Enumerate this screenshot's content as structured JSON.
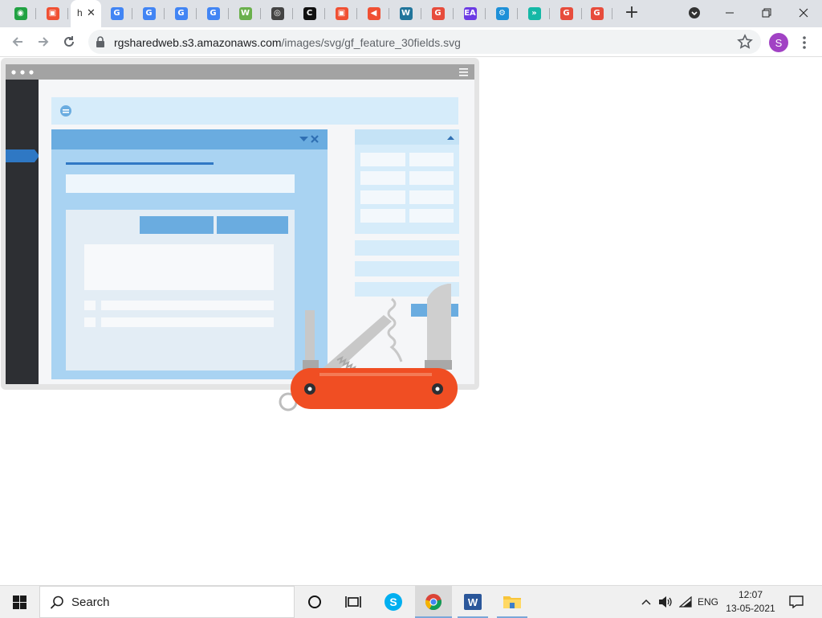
{
  "browser": {
    "active_tab_title": "h",
    "tabs": [
      {
        "icon": "green-spiral-favicon",
        "color": "#21a243",
        "glyph": "◉"
      },
      {
        "icon": "orange-shield-favicon",
        "color": "#f05033",
        "glyph": "▣"
      },
      {
        "icon": "active-tab",
        "active": true
      },
      {
        "icon": "google-favicon",
        "color": "#4285f4",
        "glyph": "G"
      },
      {
        "icon": "google-favicon",
        "color": "#4285f4",
        "glyph": "G"
      },
      {
        "icon": "google-favicon",
        "color": "#4285f4",
        "glyph": "G"
      },
      {
        "icon": "google-favicon",
        "color": "#4285f4",
        "glyph": "G"
      },
      {
        "icon": "w-favicon",
        "color": "#6ab04c",
        "glyph": "W"
      },
      {
        "icon": "circle-favicon",
        "color": "#444444",
        "glyph": "◎"
      },
      {
        "icon": "c-favicon",
        "color": "#111111",
        "glyph": "C"
      },
      {
        "icon": "orange-shield-favicon",
        "color": "#f05033",
        "glyph": "▣"
      },
      {
        "icon": "megaphone-favicon",
        "color": "#f05033",
        "glyph": "◀"
      },
      {
        "icon": "wordpress-favicon",
        "color": "#21759b",
        "glyph": "W"
      },
      {
        "icon": "g-red-favicon",
        "color": "#e74c3c",
        "glyph": "G"
      },
      {
        "icon": "ea-favicon",
        "color": "#6c3be4",
        "glyph": "EA"
      },
      {
        "icon": "gear-favicon",
        "color": "#1e90d8",
        "glyph": "⚙"
      },
      {
        "icon": "arrows-favicon",
        "color": "#15b8a6",
        "glyph": "»"
      },
      {
        "icon": "g-red-favicon",
        "color": "#e74c3c",
        "glyph": "G"
      },
      {
        "icon": "g-red-favicon",
        "color": "#e74c3c",
        "glyph": "G"
      }
    ],
    "url_host": "rgsharedweb.s3.amazonaws.com",
    "url_path": "/images/svg/gf_feature_30fields.svg",
    "profile_initial": "S",
    "colors": {
      "tabstrip": "#dee1e6",
      "omnibox": "#f1f3f4",
      "avatar": "#a142c4"
    }
  },
  "illustration": {
    "description_colors": {
      "sidebar": "#2d2f33",
      "panel": "#a9d3f2",
      "header": "#6aace0",
      "knife": "#f04e23"
    }
  },
  "taskbar": {
    "search_label": "Search",
    "language": "ENG",
    "time": "12:07",
    "date": "13-05-2021"
  }
}
